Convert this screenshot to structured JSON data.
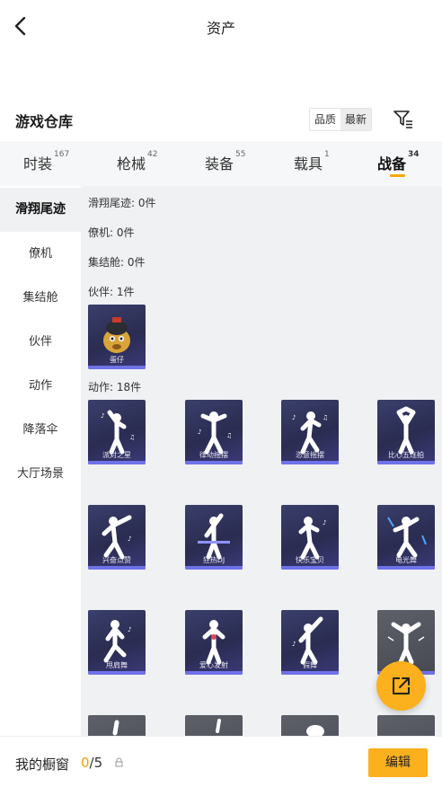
{
  "header": {
    "title": "资产",
    "back_icon": "chevron-left-icon"
  },
  "section": {
    "title": "游戏仓库",
    "sort_options": [
      "品质",
      "最新"
    ],
    "active_sort": "最新",
    "filter_icon": "filter-icon"
  },
  "tabs": [
    {
      "label": "时装",
      "count": "167"
    },
    {
      "label": "枪械",
      "count": "42"
    },
    {
      "label": "装备",
      "count": "55"
    },
    {
      "label": "载具",
      "count": "1"
    },
    {
      "label": "战备",
      "count": "34",
      "active": true
    }
  ],
  "sidebar": {
    "items": [
      {
        "label": "滑翔尾迹",
        "active": true
      },
      {
        "label": "僚机"
      },
      {
        "label": "集结舱"
      },
      {
        "label": "伙伴"
      },
      {
        "label": "动作"
      },
      {
        "label": "降落伞"
      },
      {
        "label": "大厅场景"
      }
    ]
  },
  "content": {
    "categories": [
      {
        "label": "滑翔尾迹: 0件"
      },
      {
        "label": "僚机: 0件"
      },
      {
        "label": "集结舱: 0件"
      },
      {
        "label": "伙伴: 1件"
      },
      {
        "label": "动作: 18件"
      }
    ],
    "partner_items": [
      {
        "name": "蛋仔"
      }
    ],
    "action_items": [
      {
        "name": "派对之星"
      },
      {
        "name": "律动摇摆"
      },
      {
        "name": "恣意摇摆"
      },
      {
        "name": "比心五连拍"
      },
      {
        "name": "兴奋点赞"
      },
      {
        "name": "狂热DJ"
      },
      {
        "name": "快乐宝贝"
      },
      {
        "name": "电光舞"
      },
      {
        "name": "甩肩舞"
      },
      {
        "name": "爱心发射"
      },
      {
        "name": "假舞"
      },
      {
        "name": ""
      },
      {
        "name": ""
      },
      {
        "name": ""
      },
      {
        "name": ""
      },
      {
        "name": ""
      }
    ]
  },
  "fab": {
    "icon": "share-external-icon"
  },
  "bottom": {
    "window_label": "我的橱窗",
    "current": "0",
    "total": "/5",
    "lock_icon": "lock-icon",
    "edit_label": "编辑"
  },
  "colors": {
    "accent": "#fbb01e",
    "card_purple": "#2e3058",
    "card_stripe": "#6f72e8",
    "panel_bg": "#f0f1f3"
  }
}
